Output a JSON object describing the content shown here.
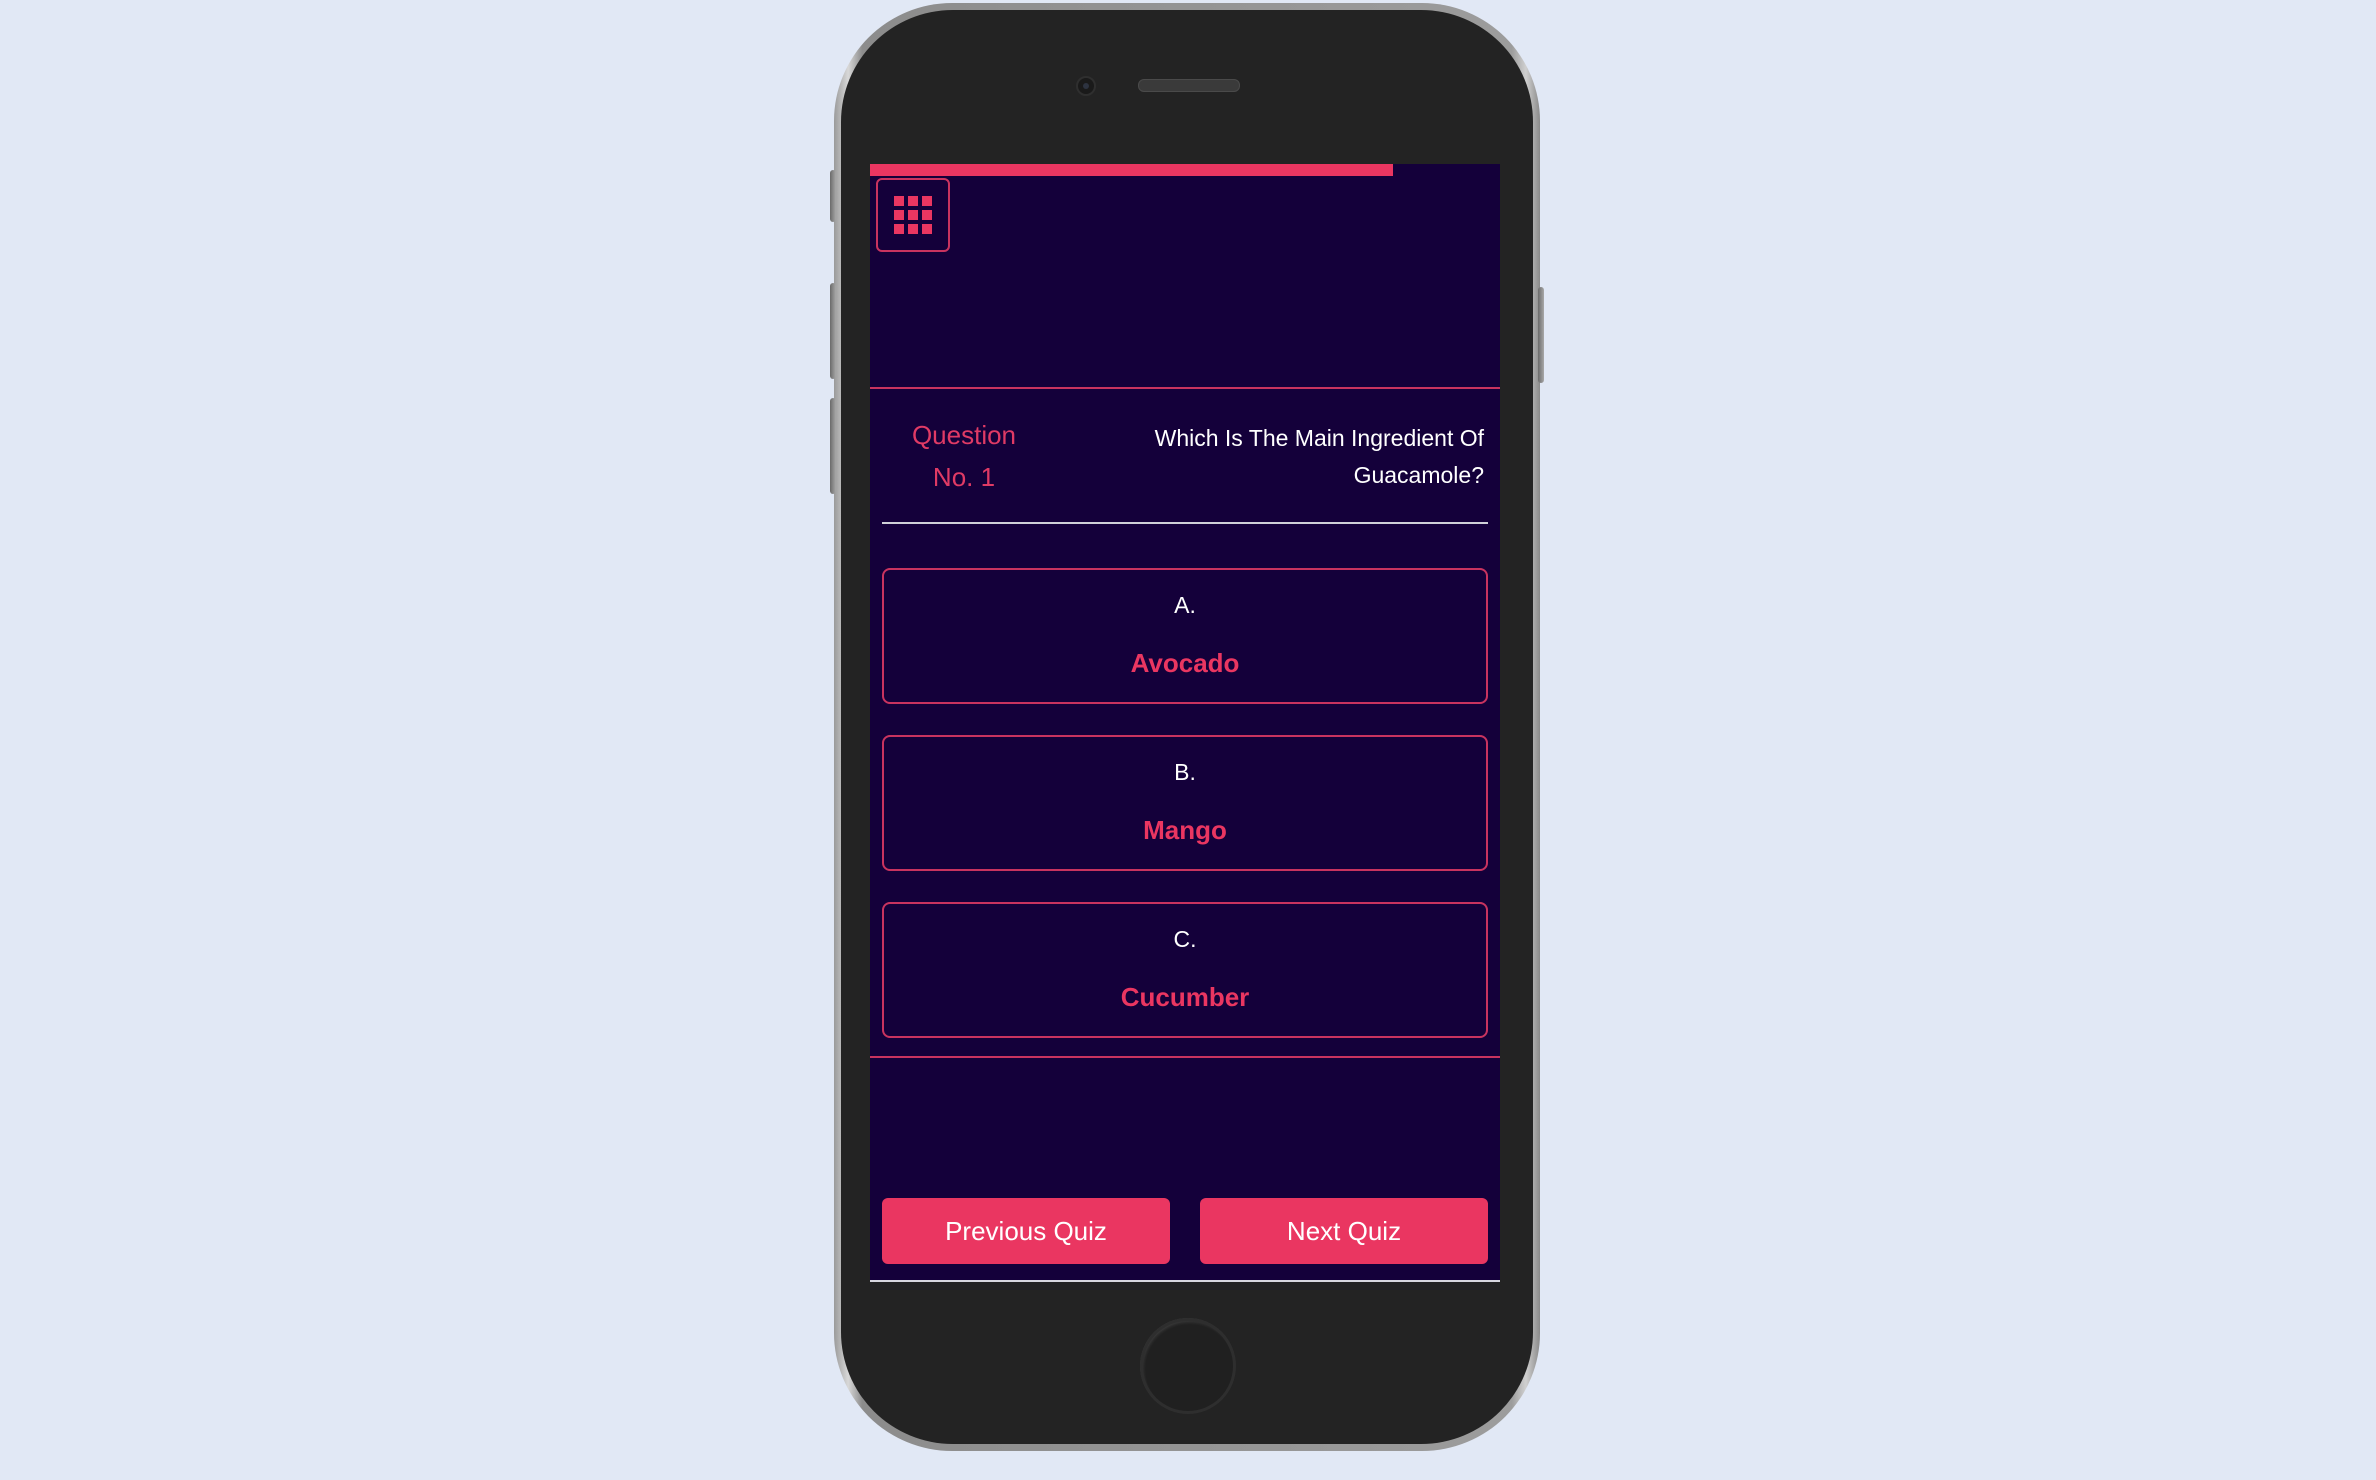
{
  "colors": {
    "background": "#e1e8f5",
    "screen": "#14003a",
    "accent": "#ea3661",
    "text": "#ffffff"
  },
  "quiz": {
    "progress_fraction": 0.83,
    "menu_icon": "grid-icon",
    "question": {
      "label_line1": "Question",
      "label_line2": "No. 1",
      "text": "Which Is The Main Ingredient Of Guacamole?"
    },
    "options": [
      {
        "letter": "A.",
        "text": "Avocado"
      },
      {
        "letter": "B.",
        "text": "Mango"
      },
      {
        "letter": "C.",
        "text": "Cucumber"
      }
    ],
    "prev_label": "Previous Quiz",
    "next_label": "Next Quiz"
  }
}
